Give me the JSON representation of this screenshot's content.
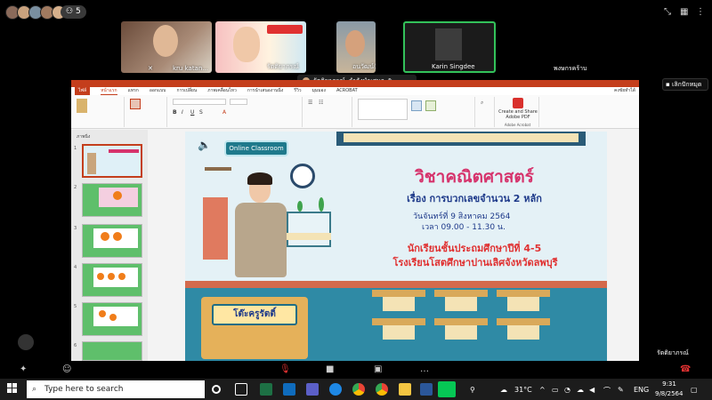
{
  "meeting": {
    "participant_count": "5",
    "participants": [
      {
        "name": "kru katan...",
        "muted": true
      },
      {
        "name": "รัตติยาภรณ์",
        "muted": false
      },
      {
        "name": "อนวัฒน์(น้องฟลัด)",
        "muted": false
      },
      {
        "name": "Karin Singdee",
        "muted": false
      },
      {
        "name": "พงษกรคร้าบ",
        "muted": false
      }
    ],
    "share_bar_name": "รัตติยาภรณ์",
    "share_bar_status": "กำลังนำเสนอ",
    "stop_label": "เลิกปักหมุด",
    "presenter_label": "รัตติยาภรณ์"
  },
  "ppt": {
    "file_tab": "ไฟล์",
    "tabs": [
      "หน้าแรก",
      "แทรก",
      "ออกแบบ",
      "การเปลี่ยน",
      "ภาพเคลื่อนไหว",
      "การนำเสนองานนิ่ง",
      "รีวิว",
      "มุมมอง",
      "ACROBAT"
    ],
    "account_label": "คงชัยทำได้",
    "create_pdf_label": "Create and Share Adobe PDF",
    "pdf_group_label": "Adobe Acrobat",
    "slides_panel_label": "ภาพนิ่ง",
    "slide": {
      "badge": "Online Classroom",
      "title": "วิชาคณิตศาสตร์",
      "subtitle": "เรื่อง การบวกเลขจำนวน 2 หลัก",
      "date": "วันจันทร์ที่ 9 สิงหาคม 2564",
      "time": "เวลา 09.00 - 11.30 น.",
      "grade": "นักเรียนชั้นประถมศึกษาปีที่ 4-5",
      "school": "โรงเรียนโสตศึกษาปานเลิศจังหวัดลพบุรี",
      "desk_sign": "โต๊ะครูรัตติ์"
    },
    "thumbnails": [
      "1",
      "2",
      "3",
      "4",
      "5",
      "6"
    ]
  },
  "taskbar": {
    "search_placeholder": "Type here to search",
    "weather": "31°C",
    "lang": "ENG",
    "time": "9:31",
    "date": "9/8/2564"
  },
  "colors": {
    "accent": "#c43e1c",
    "slide_title": "#d6336c",
    "slide_navy": "#1e3a8a",
    "slide_red": "#e03131",
    "classroom_teal": "#3b9ab2"
  }
}
